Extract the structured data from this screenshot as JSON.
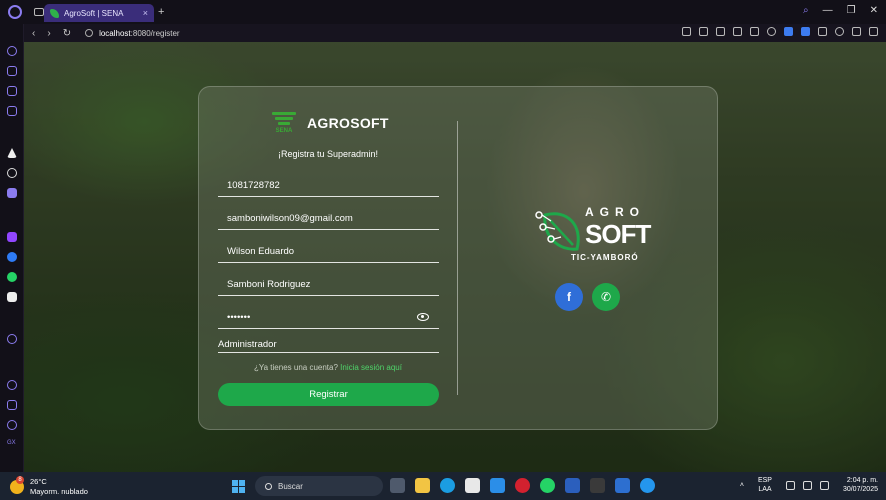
{
  "browser": {
    "tab_title": "AgroSoft | SENA",
    "url_host": "localhost",
    "url_path": ":8080/register",
    "new_tab_symbol": "+",
    "close_symbol": "×"
  },
  "form": {
    "brand_name": "AGROSOFT",
    "sena_label": "SENA",
    "subtitle": "¡Registra tu Superadmin!",
    "document_value": "1081728782",
    "email_value": "samboniwilson09@gmail.com",
    "first_name_value": "Wilson Eduardo",
    "last_name_value": "Samboni Rodriguez",
    "password_value": "•••••••",
    "role_value": "Administrador",
    "login_prompt": "¿Ya tienes una cuenta?",
    "login_link": "Inicia sesión aquí",
    "submit_label": "Registrar"
  },
  "side": {
    "logo_line1": "AGRO",
    "logo_line2": "SOFT",
    "logo_line3": "TIC-YAMBORÓ",
    "facebook_glyph": "f",
    "whatsapp_glyph": "✆"
  },
  "taskbar": {
    "temperature": "26°C",
    "weather_text": "Mayorm. nublado",
    "weather_badge": "8",
    "search_placeholder": "Buscar",
    "lang_line1": "ESP",
    "lang_line2": "LAA",
    "time": "2:04 p. m.",
    "date": "30/07/2025"
  },
  "colors": {
    "accent_green": "#1ea84a",
    "facebook_blue": "#2f6ed8",
    "opera_purple": "#8b7cf0"
  }
}
